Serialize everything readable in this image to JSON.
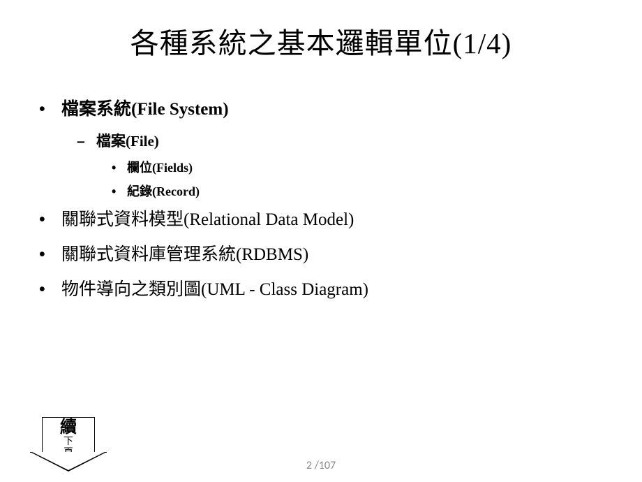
{
  "title": "各種系統之基本邏輯單位(1/4)",
  "items": {
    "file_system": "檔案系統(File System)",
    "file": "檔案(File)",
    "fields": "欄位(Fields)",
    "record": "紀錄(Record)",
    "relational_model": "關聯式資料模型(Relational Data Model)",
    "rdbms": "關聯式資料庫管理系統(RDBMS)",
    "uml": "物件導向之類別圖(UML - Class Diagram)"
  },
  "arrow": {
    "main": "續",
    "sub1": "下",
    "sub2": "頁"
  },
  "page": "2 /107"
}
